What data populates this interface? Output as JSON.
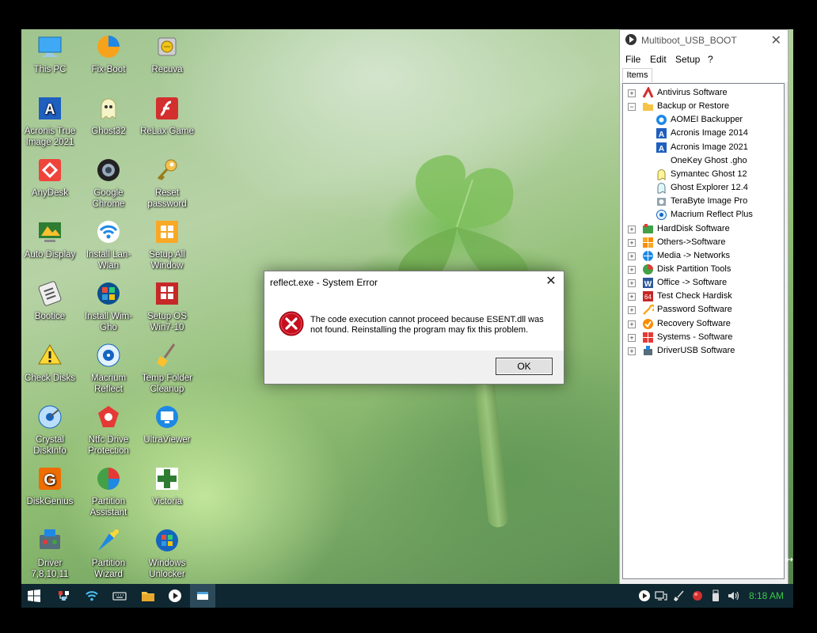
{
  "desktop": {
    "icons": [
      {
        "label": "This PC"
      },
      {
        "label": "Fix-Boot"
      },
      {
        "label": "Recuva"
      },
      {
        "label": "Acronis True Image 2021"
      },
      {
        "label": "Ghost32"
      },
      {
        "label": "ReLax Game"
      },
      {
        "label": "AnyDesk"
      },
      {
        "label": "Google Chrome"
      },
      {
        "label": "Reset password"
      },
      {
        "label": "Auto Display"
      },
      {
        "label": "Install Lan-Wlan"
      },
      {
        "label": "Setup All Window"
      },
      {
        "label": "Bootice"
      },
      {
        "label": "Install Wim-Gho"
      },
      {
        "label": "Setup OS Win7-10"
      },
      {
        "label": "Check Disks"
      },
      {
        "label": "Macrium Reflect"
      },
      {
        "label": "Temp Folder Cleanup"
      },
      {
        "label": "Crystal DiskInfo"
      },
      {
        "label": "Ntfc Drive Protection"
      },
      {
        "label": "UltraViewer"
      },
      {
        "label": "DiskGenius"
      },
      {
        "label": "Partition Assistant"
      },
      {
        "label": "Victoria"
      },
      {
        "label": "Driver 7,8,10,11"
      },
      {
        "label": "Partition Wizard"
      },
      {
        "label": "Windows Unlocker"
      }
    ]
  },
  "dialog": {
    "title": "reflect.exe - System Error",
    "message": "The code execution cannot proceed because ESENT.dll was not found. Reinstalling the program may fix this problem.",
    "ok_label": "OK",
    "close_glyph": "✕"
  },
  "panel": {
    "title": "Multiboot_USB_BOOT",
    "close_glyph": "✕",
    "menu": [
      "File",
      "Edit",
      "Setup",
      "?"
    ],
    "tab": "Items",
    "tree": [
      {
        "label": "Antivirus Software",
        "level": 0,
        "exp": "+"
      },
      {
        "label": "Backup or Restore",
        "level": 0,
        "exp": "−"
      },
      {
        "label": "AOMEI Backupper",
        "level": 1
      },
      {
        "label": "Acronis Image 2014",
        "level": 1
      },
      {
        "label": "Acronis Image 2021",
        "level": 1
      },
      {
        "label": "OneKey Ghost .gho",
        "level": 1
      },
      {
        "label": "Symantec Ghost 12",
        "level": 1
      },
      {
        "label": "Ghost Explorer 12.4",
        "level": 1
      },
      {
        "label": "TeraByte Image Pro",
        "level": 1
      },
      {
        "label": "Macrium Reflect Plus",
        "level": 1
      },
      {
        "label": "HardDisk Software",
        "level": 0,
        "exp": "+"
      },
      {
        "label": "Others->Software",
        "level": 0,
        "exp": "+"
      },
      {
        "label": "Media -> Networks",
        "level": 0,
        "exp": "+"
      },
      {
        "label": "Disk Partition Tools",
        "level": 0,
        "exp": "+"
      },
      {
        "label": "Office -> Software",
        "level": 0,
        "exp": "+"
      },
      {
        "label": "Test Check Hardisk",
        "level": 0,
        "exp": "+"
      },
      {
        "label": "Password Software",
        "level": 0,
        "exp": "+"
      },
      {
        "label": "Recovery Software",
        "level": 0,
        "exp": "+"
      },
      {
        "label": "Systems - Software",
        "level": 0,
        "exp": "+"
      },
      {
        "label": "DriverUSB Software",
        "level": 0,
        "exp": "+"
      }
    ]
  },
  "taskbar": {
    "clock": "8:18 AM"
  }
}
